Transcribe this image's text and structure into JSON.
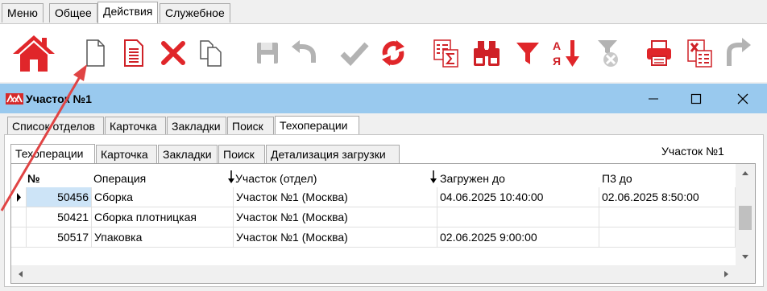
{
  "menu": {
    "tabs": [
      "Меню",
      "Общее",
      "Действия",
      "Служебное"
    ],
    "active_index": 2
  },
  "toolbar": {
    "buttons": [
      {
        "icon": "home-icon"
      },
      {
        "icon": "new-document-icon"
      },
      {
        "icon": "edit-document-icon"
      },
      {
        "icon": "delete-icon"
      },
      {
        "icon": "copy-icon"
      },
      {
        "icon": "save-icon"
      },
      {
        "icon": "undo-icon"
      },
      {
        "icon": "checkmark-icon"
      },
      {
        "icon": "refresh-icon"
      },
      {
        "icon": "sum-report-icon"
      },
      {
        "icon": "binoculars-icon"
      },
      {
        "icon": "filter-icon"
      },
      {
        "icon": "sort-alpha-icon"
      },
      {
        "icon": "clear-filter-icon"
      },
      {
        "icon": "print-icon"
      },
      {
        "icon": "excel-export-icon"
      },
      {
        "icon": "forward-icon"
      }
    ]
  },
  "window": {
    "title": "Участок №1",
    "outer_tabs": [
      "Список отделов",
      "Карточка",
      "Закладки",
      "Поиск",
      "Техоперации"
    ],
    "outer_active": 4,
    "inner_tabs": [
      "Техоперации",
      "Карточка",
      "Закладки",
      "Поиск",
      "Детализация загрузки"
    ],
    "inner_active": 0,
    "area_label": "Участок №1"
  },
  "grid": {
    "columns": [
      "№",
      "Операция",
      "Участок (отдел)",
      "Загружен до",
      "П3 до"
    ],
    "rows": [
      {
        "num": "50456",
        "op": "Сборка",
        "area": "Участок №1 (Москва)",
        "loaded": "04.06.2025 10:40:00",
        "pz": "02.06.2025 8:50:00",
        "current": true
      },
      {
        "num": "50421",
        "op": "Сборка плотницкая",
        "area": "Участок №1 (Москва)",
        "loaded": "",
        "pz": "",
        "current": false
      },
      {
        "num": "50517",
        "op": "Упаковка",
        "area": "Участок №1 (Москва)",
        "loaded": "02.06.2025 9:00:00",
        "pz": "",
        "current": false
      }
    ]
  },
  "colors": {
    "accent_red": "#e0262a",
    "titlebar": "#99c9ee",
    "selection": "#cde4f7"
  }
}
